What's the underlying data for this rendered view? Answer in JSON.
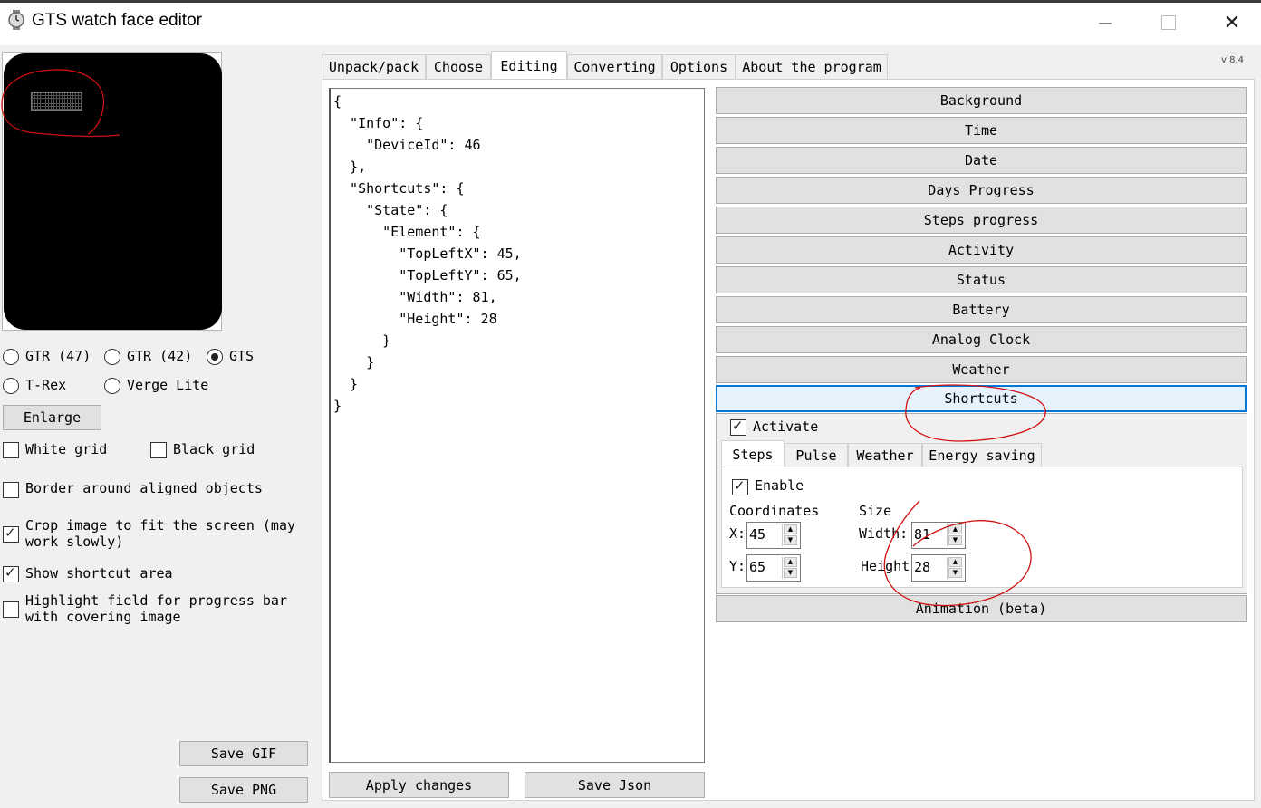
{
  "window": {
    "title": "GTS watch face editor",
    "icon": "watch-icon",
    "minimize_icon": "minimize-icon",
    "maximize_icon": "maximize-icon",
    "close_icon": "close-icon"
  },
  "version": "v 8.4",
  "tabs": [
    {
      "label": "Unpack/pack"
    },
    {
      "label": "Choose"
    },
    {
      "label": "Editing",
      "active": true
    },
    {
      "label": "Converting"
    },
    {
      "label": "Options"
    },
    {
      "label": "About the program"
    }
  ],
  "left": {
    "models": [
      {
        "label": "GTR (47)",
        "selected": false
      },
      {
        "label": "GTR (42)",
        "selected": false
      },
      {
        "label": "GTS",
        "selected": true
      },
      {
        "label": "T-Rex",
        "selected": false
      },
      {
        "label": "Verge Lite",
        "selected": false
      }
    ],
    "enlarge": "Enlarge",
    "checks": [
      {
        "label": "White grid",
        "checked": false
      },
      {
        "label": "Black grid",
        "checked": false
      },
      {
        "label": "Border around aligned objects",
        "checked": false
      },
      {
        "label_line1": "Crop image to fit the screen (may",
        "label_line2": "work slowly)",
        "checked": true
      },
      {
        "label": "Show shortcut area",
        "checked": true
      },
      {
        "label_line1": "Highlight field for progress bar",
        "label_line2": "with covering image",
        "checked": false
      }
    ],
    "save_gif": "Save GIF",
    "save_png": "Save PNG"
  },
  "editor": {
    "json_lines": [
      "{",
      "  \"Info\": {",
      "    \"DeviceId\": 46",
      "  },",
      "  \"Shortcuts\": {",
      "    \"State\": {",
      "      \"Element\": {",
      "        \"TopLeftX\": 45,",
      "        \"TopLeftY\": 65,",
      "        \"Width\": 81,",
      "        \"Height\": 28",
      "      }",
      "    }",
      "  }",
      "}"
    ],
    "apply": "Apply changes",
    "save_json": "Save Json"
  },
  "sections": [
    {
      "label": "Background"
    },
    {
      "label": "Time"
    },
    {
      "label": "Date"
    },
    {
      "label": "Days Progress"
    },
    {
      "label": "Steps progress"
    },
    {
      "label": "Activity"
    },
    {
      "label": "Status"
    },
    {
      "label": "Battery"
    },
    {
      "label": "Analog Clock"
    },
    {
      "label": "Weather"
    },
    {
      "label": "Shortcuts",
      "selected": true
    }
  ],
  "animation": "Animation (beta)",
  "shortcuts": {
    "activate": {
      "label": "Activate",
      "checked": true
    },
    "subtabs": [
      {
        "label": "Steps",
        "active": true
      },
      {
        "label": "Pulse"
      },
      {
        "label": "Weather"
      },
      {
        "label": "Energy saving"
      }
    ],
    "enable": {
      "label": "Enable",
      "checked": true
    },
    "coordinates_label": "Coordinates",
    "size_label": "Size",
    "x_label": "X:",
    "y_label": "Y:",
    "width_label": "Width:",
    "height_label": "Height",
    "x": "45",
    "y": "65",
    "width": "81",
    "height": "28"
  },
  "colors": {
    "annotation": "#d01010",
    "selection": "#0078d7"
  }
}
